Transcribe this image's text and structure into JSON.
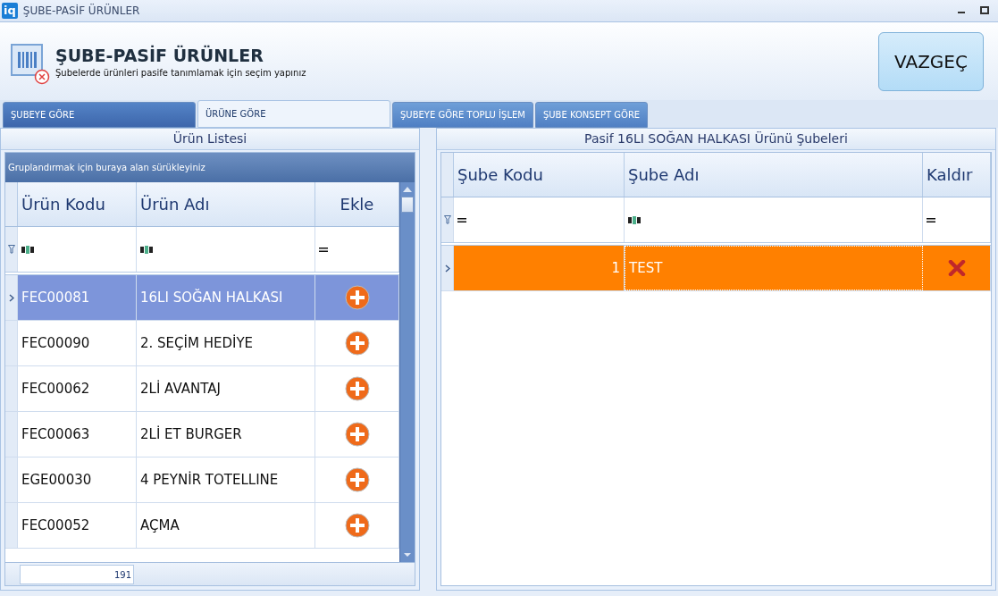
{
  "window": {
    "logo": "iq",
    "title": "ŞUBE-PASİF ÜRÜNLER"
  },
  "header": {
    "title": "ŞUBE-PASİF ÜRÜNLER",
    "subtitle": "Şubelerde ürünleri pasife tanımlamak için seçim yapınız"
  },
  "cancel_button": "VAZGEÇ",
  "tabs": [
    {
      "label": "ŞUBEYE GÖRE",
      "selected": false,
      "hovered": true
    },
    {
      "label": "ÜRÜNE GÖRE",
      "selected": true,
      "hovered": false
    },
    {
      "label": "ŞUBEYE GÖRE TOPLU İŞLEM",
      "selected": false,
      "hovered": false
    },
    {
      "label": "ŞUBE KONSEPT GÖRE",
      "selected": false,
      "hovered": false
    }
  ],
  "product_list": {
    "title": "Ürün Listesi",
    "group_hint": "Gruplandırmak için buraya alan sürükleyiniz",
    "columns": [
      {
        "label": "Ürün Kodu",
        "filter": {
          "kind": "text"
        }
      },
      {
        "label": "Ürün Adı",
        "filter": {
          "kind": "text"
        }
      },
      {
        "label": "Ekle",
        "filter": {
          "kind": "equals"
        }
      }
    ],
    "rows": [
      {
        "code": "FEC00081",
        "name": "16LI SOĞAN HALKASI",
        "selected": true
      },
      {
        "code": "FEC00090",
        "name": "2. SEÇİM HEDİYE",
        "selected": false
      },
      {
        "code": "FEC00062",
        "name": "2Lİ AVANTAJ",
        "selected": false
      },
      {
        "code": "FEC00063",
        "name": "2Lİ ET BURGER",
        "selected": false
      },
      {
        "code": "EGE00030",
        "name": "4 PEYNİR TOTELLINE",
        "selected": false
      },
      {
        "code": "FEC00052",
        "name": "AÇMA",
        "selected": false
      }
    ],
    "count": "191"
  },
  "branch_list": {
    "title": "Pasif 16LI SOĞAN HALKASI Ürünü Şubeleri",
    "columns": [
      {
        "label": "Şube Kodu",
        "filter": {
          "kind": "equals"
        }
      },
      {
        "label": "Şube Adı",
        "filter": {
          "kind": "text"
        }
      },
      {
        "label": "Kaldır",
        "filter": {
          "kind": "equals"
        }
      }
    ],
    "rows": [
      {
        "code": "1",
        "name": "TEST",
        "selected": true
      }
    ]
  }
}
